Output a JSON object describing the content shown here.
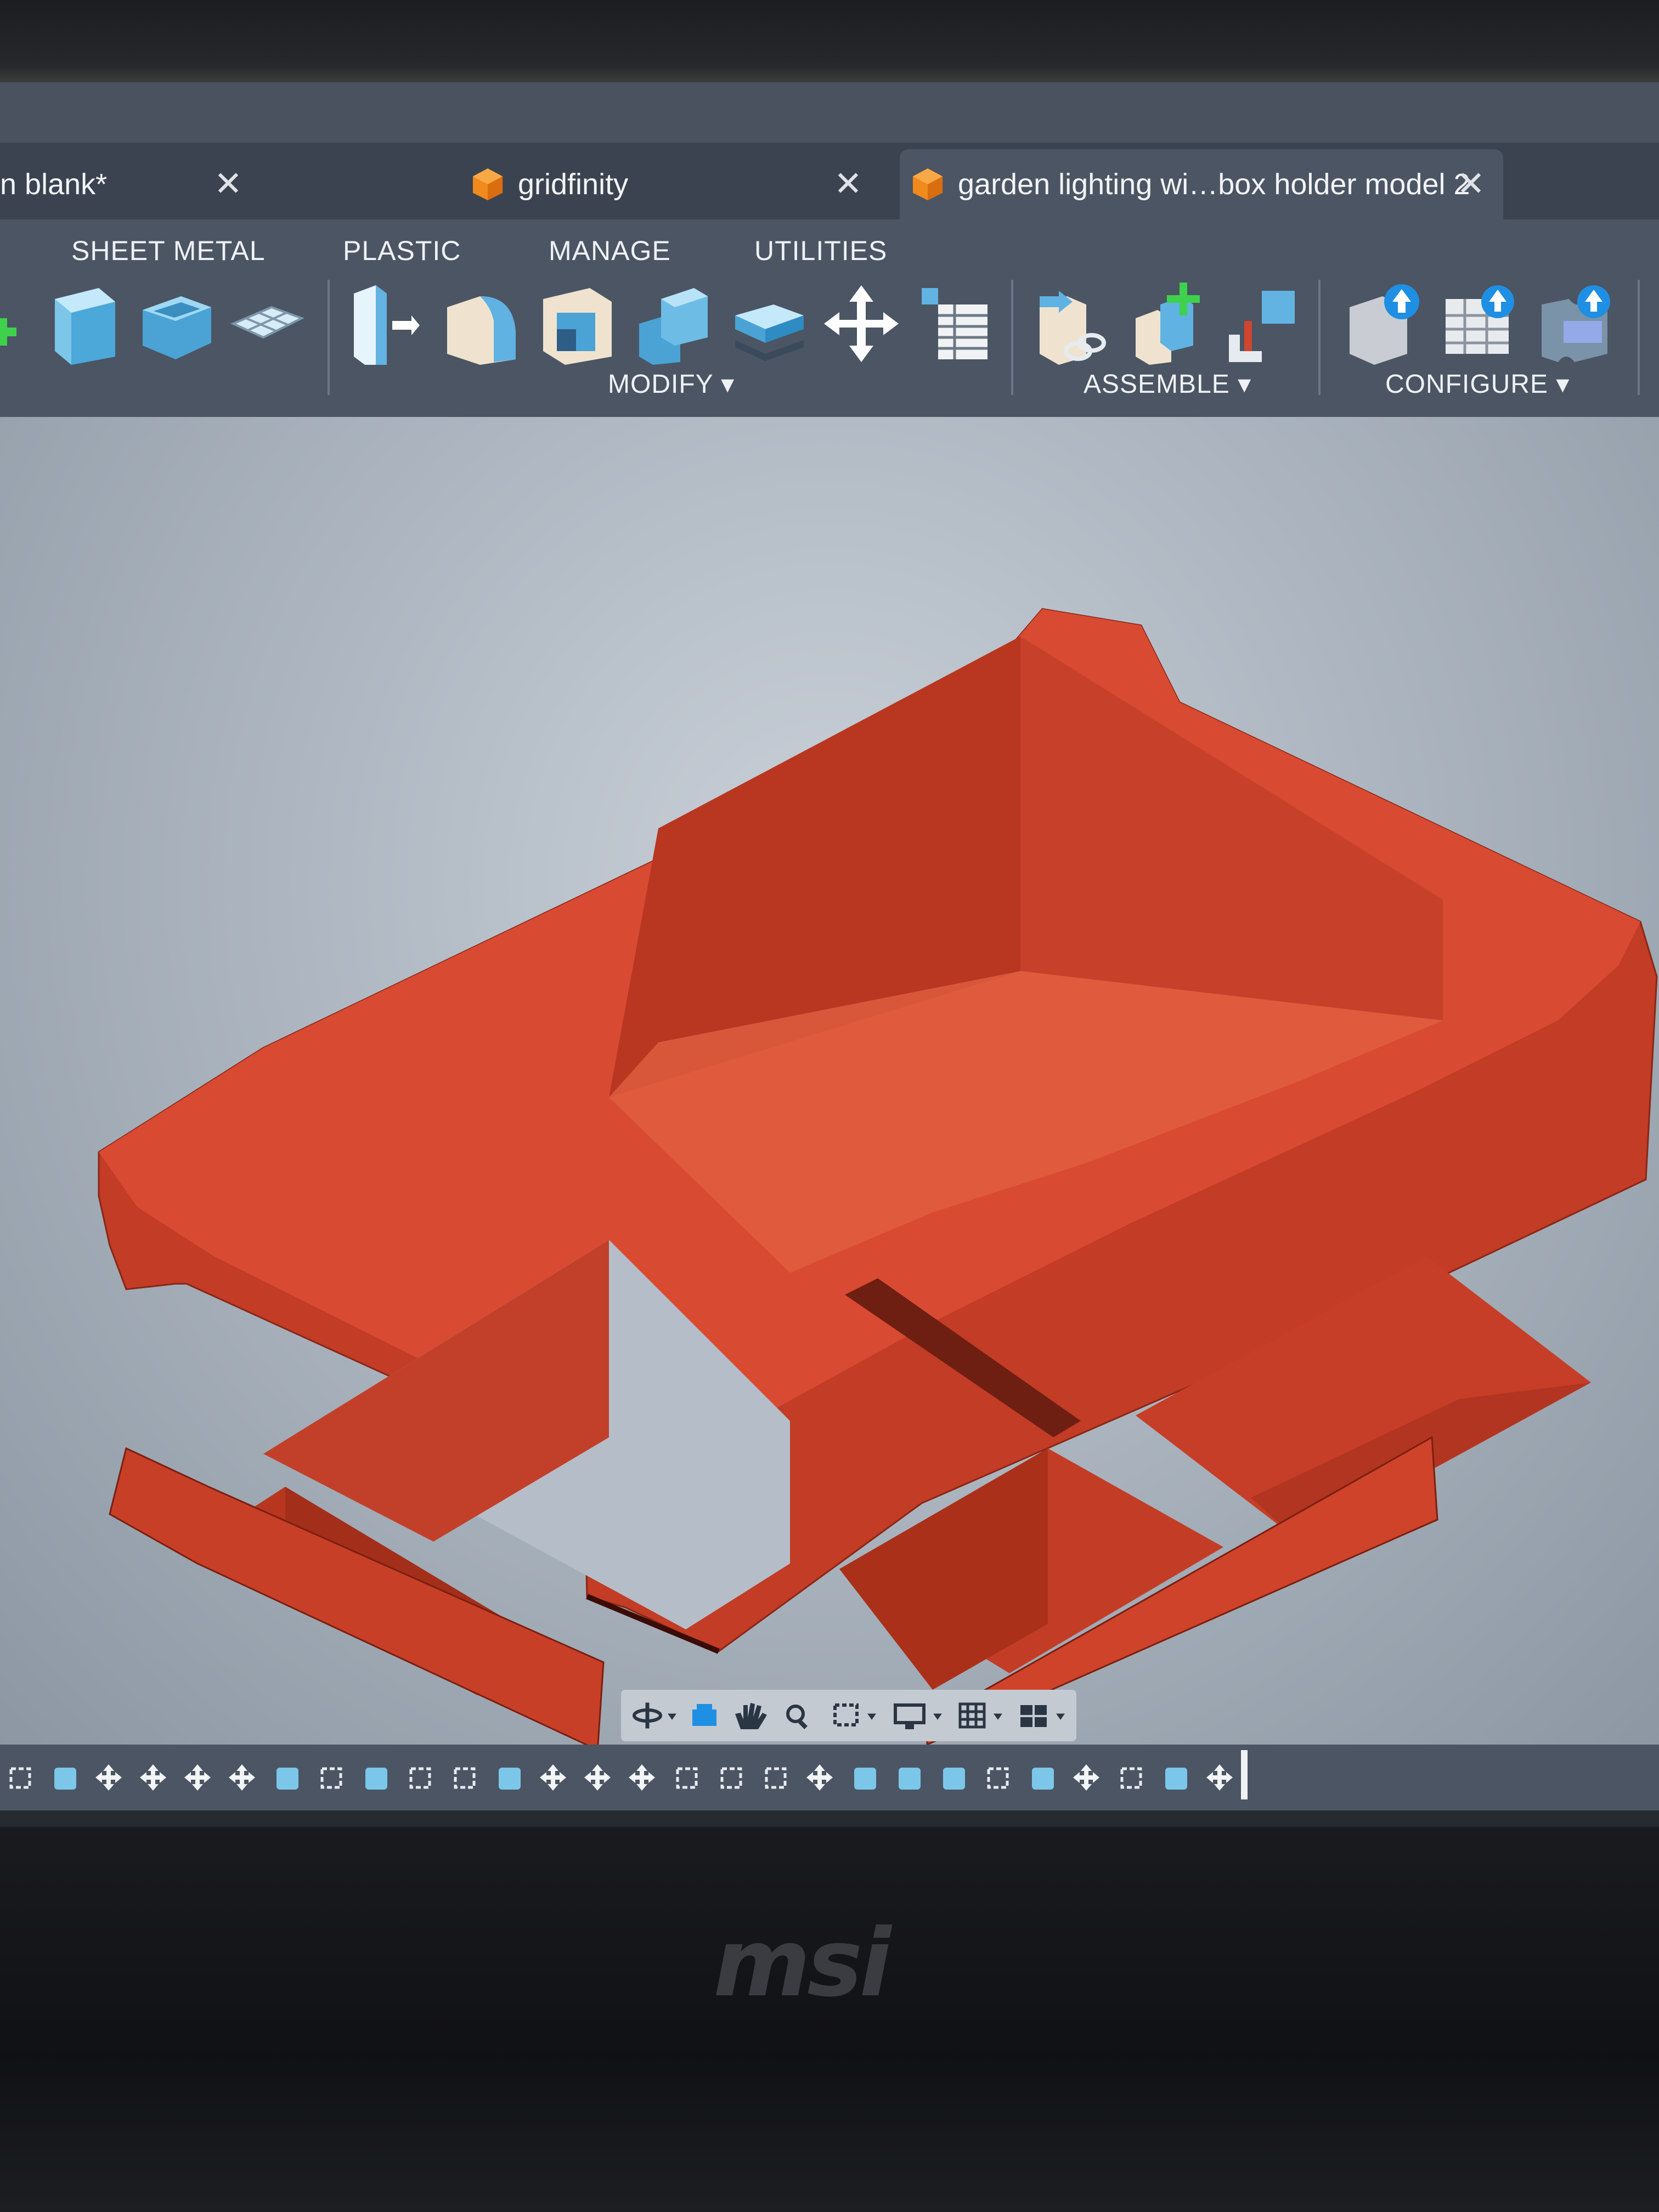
{
  "tabs": [
    {
      "label": "n blank*",
      "active": false
    },
    {
      "label": "gridfinity",
      "active": false
    },
    {
      "label": "garden lighting wi…box holder model 2",
      "active": true
    }
  ],
  "tab_close_glyph": "✕",
  "toolbar": {
    "tabs": [
      "SHEET METAL",
      "PLASTIC",
      "MANAGE",
      "UTILITIES"
    ],
    "groups": [
      "MODIFY ▾",
      "ASSEMBLE ▾",
      "CONFIGURE ▾"
    ]
  },
  "model_color": "#d2452e",
  "brand": "msi",
  "icons": {
    "tab": "fusion-document-icon",
    "navbar": [
      "orbit-icon",
      "look-at-icon",
      "pan-icon",
      "zoom-icon",
      "fit-icon",
      "display-settings-icon",
      "grid-icon",
      "viewports-icon"
    ]
  }
}
